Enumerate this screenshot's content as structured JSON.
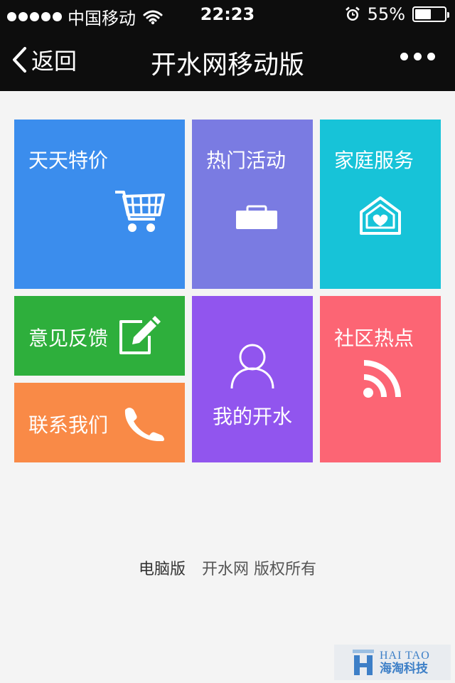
{
  "status_bar": {
    "carrier": "中国移动",
    "time": "22:23",
    "battery": "55%",
    "battery_level": 0.55
  },
  "nav": {
    "back_label": "返回",
    "title": "开水网移动版"
  },
  "tiles": {
    "daily_deals": {
      "label": "天天特价",
      "color": "#3b8ded",
      "icon": "shopping-cart-icon"
    },
    "hot_events": {
      "label": "热门活动",
      "color": "#7a7be2",
      "icon": "briefcase-icon"
    },
    "home_service": {
      "label": "家庭服务",
      "color": "#17c3d8",
      "icon": "house-heart-icon"
    },
    "feedback": {
      "label": "意见反馈",
      "color": "#2eaf3c",
      "icon": "edit-icon"
    },
    "contact_us": {
      "label": "联系我们",
      "color": "#f98a47",
      "icon": "phone-icon"
    },
    "my_kaishui": {
      "label": "我的开水",
      "color": "#9155ee",
      "icon": "user-icon"
    },
    "community": {
      "label": "社区热点",
      "color": "#fc6574",
      "icon": "rss-icon"
    }
  },
  "footer": {
    "desktop_link": "电脑版",
    "copyright": "开水网 版权所有"
  },
  "watermark": {
    "en": "HAI TAO",
    "zh": "海淘科技"
  }
}
